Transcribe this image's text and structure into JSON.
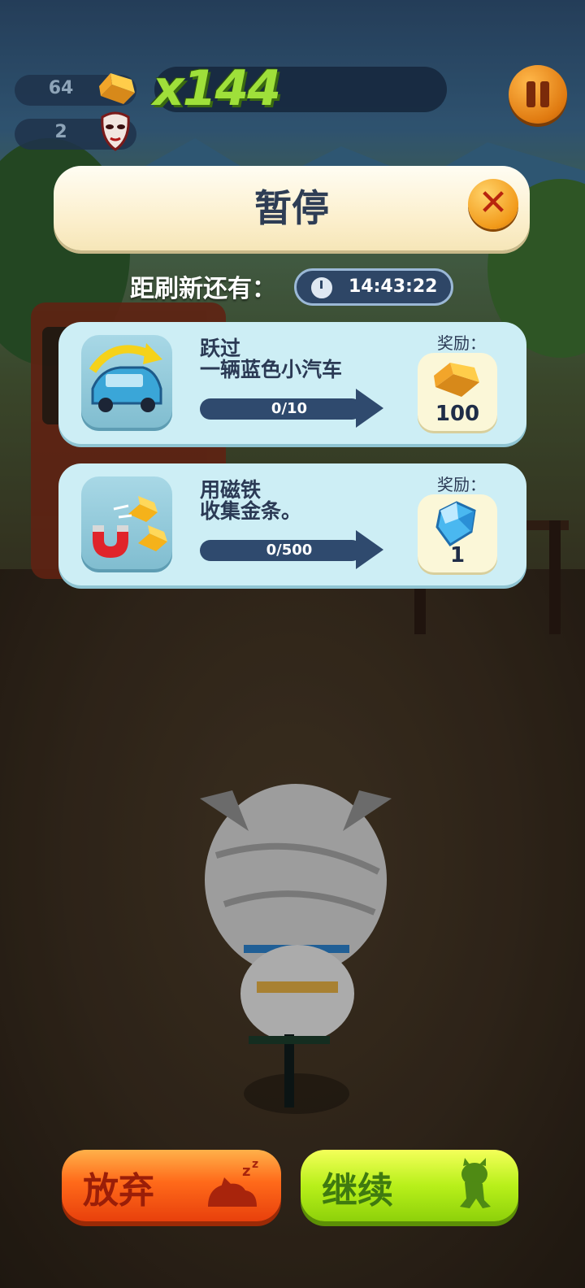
{
  "hud": {
    "gold_count": "64",
    "mask_count": "2",
    "multiplier": "x144"
  },
  "pause_dialog": {
    "title": "暂停",
    "refresh_label": "距刷新还有：",
    "refresh_timer": "14:43:22",
    "missions": [
      {
        "text": "跃过\n一辆蓝色小汽车",
        "progress": "0/10",
        "progress_fraction": 0,
        "reward_label": "奖励：",
        "reward_value": "100",
        "reward_icon": "gold-bar-icon",
        "mission_icon": "blue-car-jump-icon"
      },
      {
        "text": "用磁铁\n收集金条。",
        "progress": "0/500",
        "progress_fraction": 0,
        "reward_label": "奖励：",
        "reward_value": "1",
        "reward_icon": "diamond-icon",
        "mission_icon": "magnet-gold-icon"
      }
    ]
  },
  "buttons": {
    "quit_label": "放弃",
    "continue_label": "继续"
  },
  "colors": {
    "quit_button": "#ff6a1a",
    "continue_button": "#b8f01a",
    "card_bg": "#cdeef5",
    "title_bg": "#fcf0cf"
  }
}
